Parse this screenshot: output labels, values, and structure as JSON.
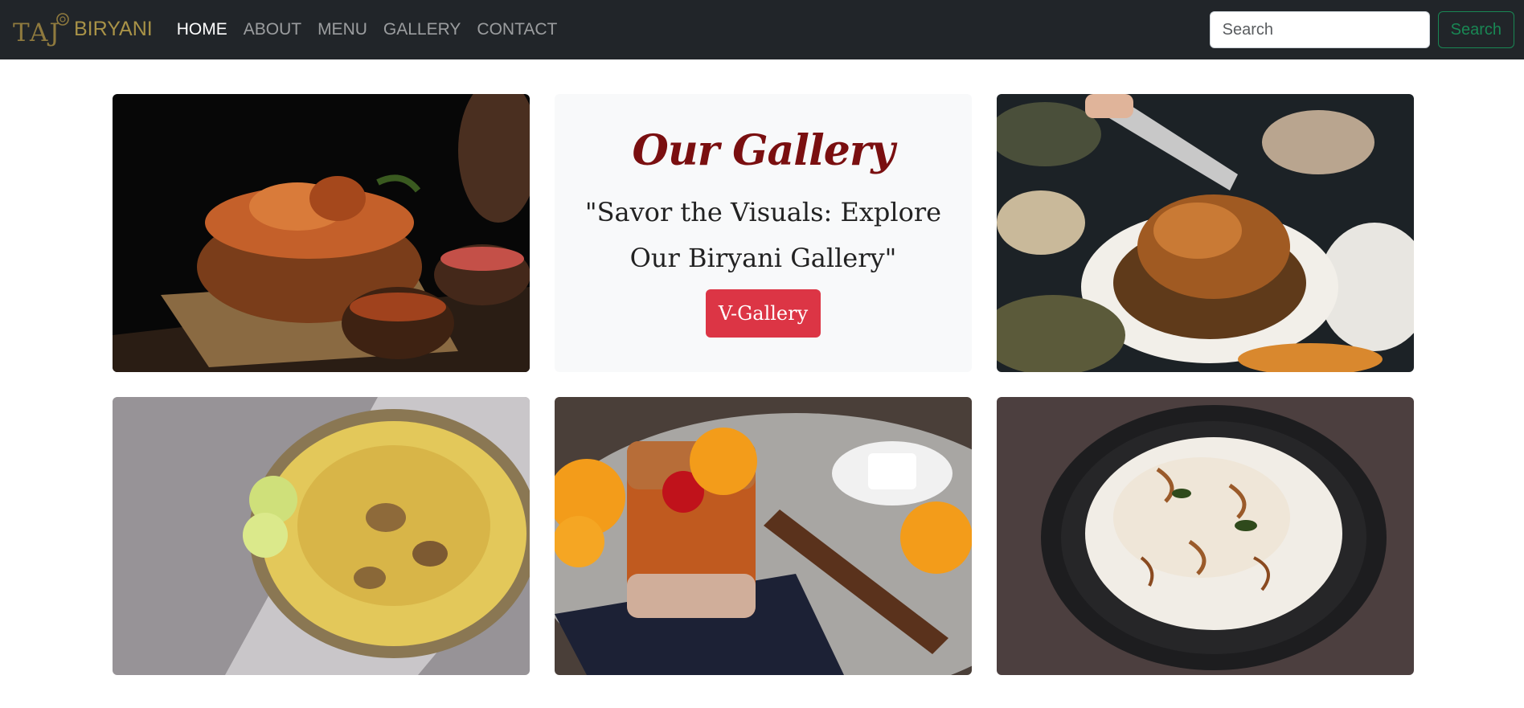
{
  "navbar": {
    "brand_taj": "TAJ",
    "brand_name": "BIRYANI",
    "links": [
      "HOME",
      "ABOUT",
      "MENU",
      "GALLERY",
      "CONTACT"
    ],
    "search_placeholder": "Search",
    "search_button": "Search"
  },
  "gallery": {
    "title": "Our Gallery",
    "quote": "\"Savor the Visuals: Explore Our Biryani Gallery\"",
    "button": "V-Gallery",
    "photos": [
      "biryani-pot-photo",
      "roast-chicken-photo",
      "biryani-platter-photo",
      "cocktail-photo",
      "rice-plate-photo"
    ]
  },
  "colors": {
    "navbar_bg": "#212529",
    "brand_gold": "#a89247",
    "title_maroon": "#7a0f10",
    "button_red": "#dc3545",
    "search_green": "#198754"
  }
}
